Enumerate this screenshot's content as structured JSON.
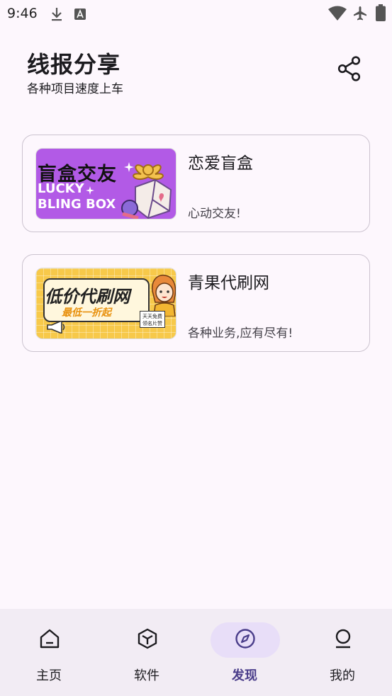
{
  "status_bar": {
    "time": "9:46",
    "icons": [
      "download-icon",
      "text-a-icon",
      "wifi-icon",
      "airplane-icon",
      "battery-icon"
    ]
  },
  "header": {
    "title": "线报分享",
    "subtitle": "各种项目速度上车",
    "share_icon": "share-icon"
  },
  "cards": [
    {
      "title": "恋爱盲盒",
      "description": "心动交友!",
      "thumbnail_text": [
        "盲盒交友",
        "LUCKY",
        "BLING BOX"
      ],
      "thumbnail_color": "#b25ae6"
    },
    {
      "title": "青果代刷网",
      "description": "各种业务,应有尽有!",
      "thumbnail_text": [
        "低价代刷网",
        "最低一折起",
        "天天免费\n领名片赞"
      ],
      "thumbnail_color": "#f7c94a"
    }
  ],
  "nav": {
    "items": [
      {
        "label": "主页",
        "icon": "home-icon",
        "active": false
      },
      {
        "label": "软件",
        "icon": "cube-icon",
        "active": false
      },
      {
        "label": "发现",
        "icon": "compass-icon",
        "active": true
      },
      {
        "label": "我的",
        "icon": "person-icon",
        "active": false
      }
    ]
  },
  "colors": {
    "background": "#fdf7fd",
    "nav_background": "#f2ecf4",
    "active_pill": "#e8def8",
    "active_text": "#4a3d8a",
    "card_border": "#cbc3cf"
  }
}
